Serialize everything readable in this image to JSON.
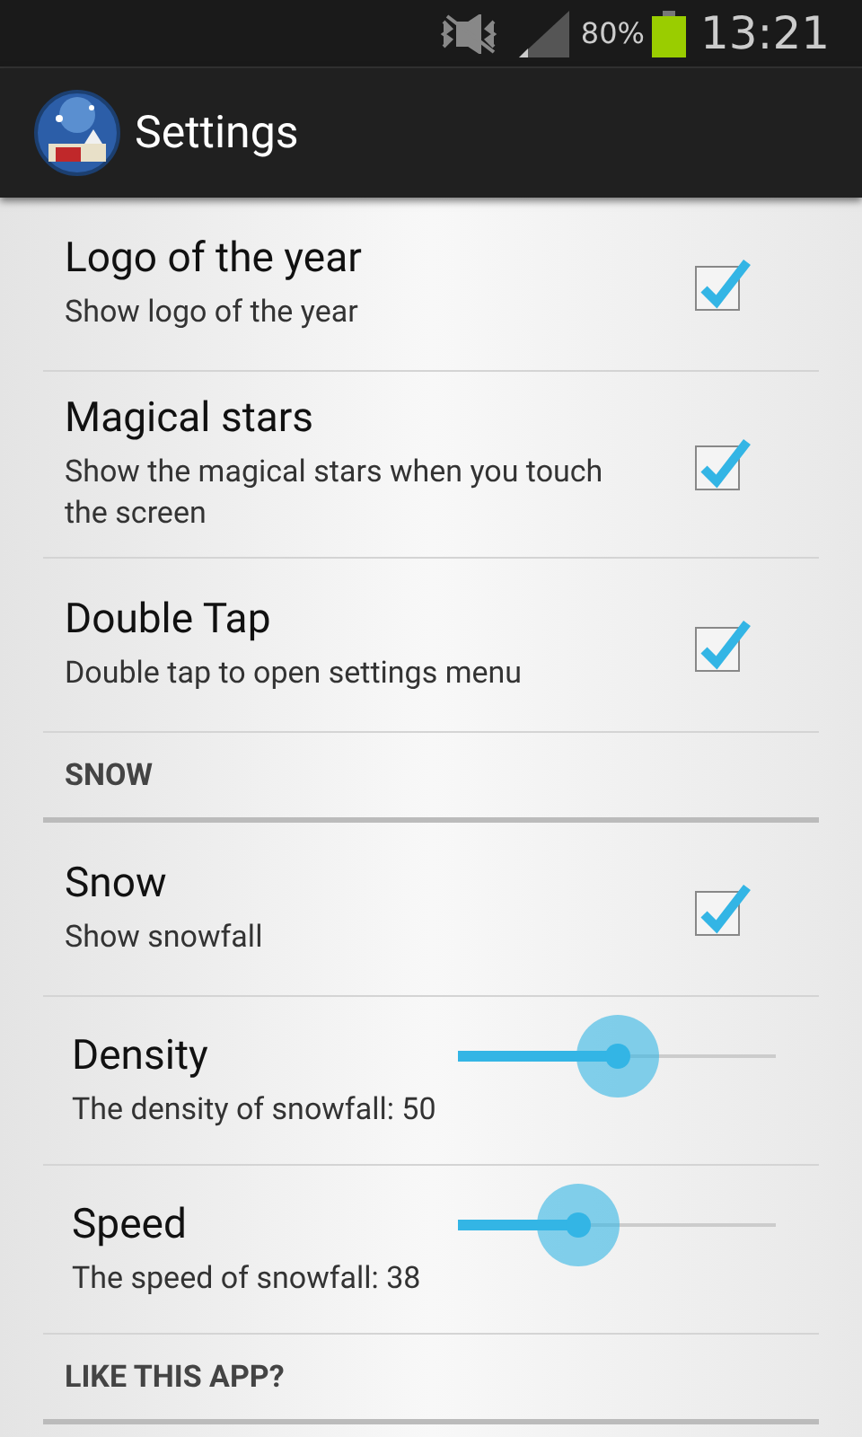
{
  "status_bar": {
    "battery_text": "80%",
    "time": "13:21"
  },
  "action_bar": {
    "title": "Settings"
  },
  "items": [
    {
      "kind": "checkbox",
      "title": "Logo of the year",
      "summary": "Show logo of the year",
      "checked": true
    },
    {
      "kind": "checkbox",
      "title": "Magical stars",
      "summary": "Show the magical stars when you touch the screen",
      "checked": true
    },
    {
      "kind": "checkbox",
      "title": "Double Tap",
      "summary": "Double tap to open settings menu",
      "checked": true
    },
    {
      "kind": "category",
      "title": "SNOW"
    },
    {
      "kind": "checkbox",
      "title": "Snow",
      "summary": "Show snowfall",
      "checked": true
    },
    {
      "kind": "slider",
      "title": "Density",
      "summary": "The density of snowfall: 50",
      "level": 0.5
    },
    {
      "kind": "slider",
      "title": "Speed",
      "summary": "The speed of snowfall: 38",
      "level": 0.38
    },
    {
      "kind": "category",
      "title": "LIKE THIS APP?"
    }
  ]
}
